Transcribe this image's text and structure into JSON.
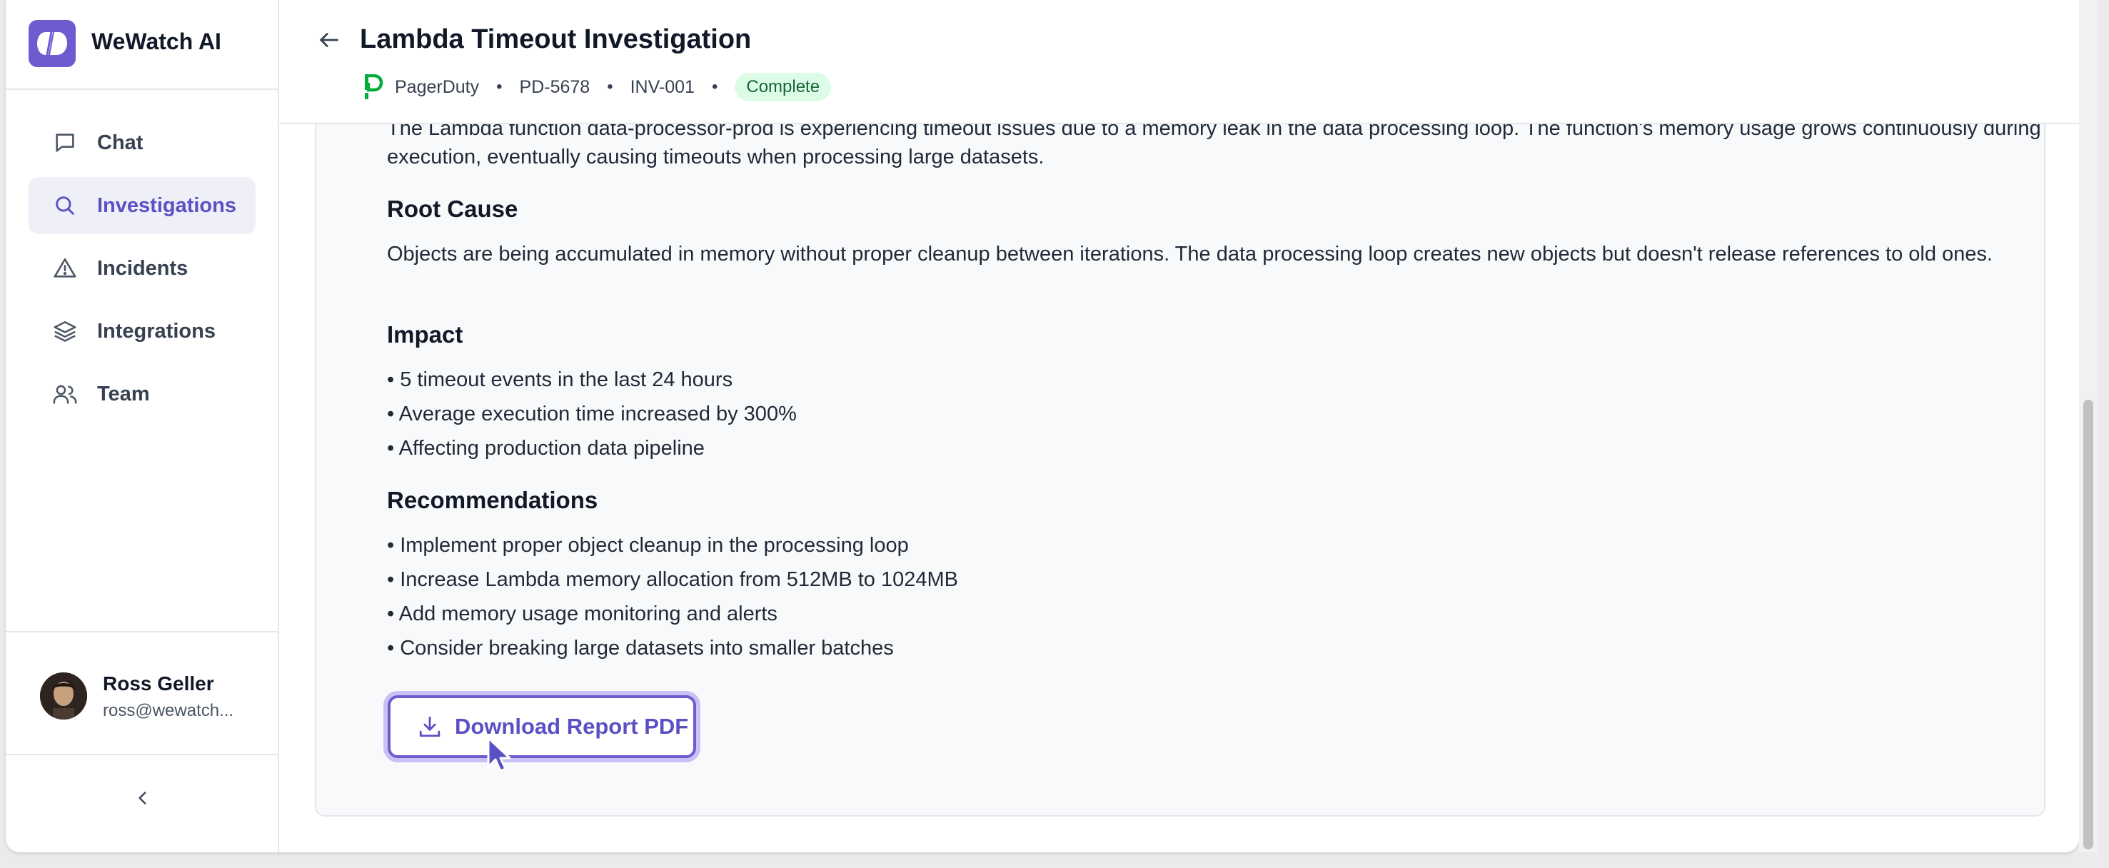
{
  "brand": {
    "name": "WeWatch AI",
    "logo_icon": "wewatch-logo-icon"
  },
  "nav": {
    "items": [
      {
        "label": "Chat",
        "icon": "chat-icon",
        "active": false
      },
      {
        "label": "Investigations",
        "icon": "search-icon",
        "active": true
      },
      {
        "label": "Incidents",
        "icon": "warning-icon",
        "active": false
      },
      {
        "label": "Integrations",
        "icon": "layers-icon",
        "active": false
      },
      {
        "label": "Team",
        "icon": "users-icon",
        "active": false
      }
    ]
  },
  "user": {
    "name": "Ross Geller",
    "email": "ross@wewatch..."
  },
  "header": {
    "title": "Lambda Timeout Investigation",
    "source": "PagerDuty",
    "incident_id": "PD-5678",
    "investigation_id": "INV-001",
    "status": "Complete"
  },
  "report": {
    "summary_text": "The Lambda function data-processor-prod is experiencing timeout issues due to a memory leak in the data processing loop. The function's memory usage grows continuously during execution, eventually causing timeouts when processing large datasets.",
    "root_cause_title": "Root Cause",
    "root_cause_text": "Objects are being accumulated in memory without proper cleanup between iterations. The data processing loop creates new objects but doesn't release references to old ones.",
    "impact_title": "Impact",
    "impact_items": [
      "• 5 timeout events in the last 24 hours",
      "• Average execution time increased by 300%",
      "• Affecting production data pipeline"
    ],
    "recommendations_title": "Recommendations",
    "recommendation_items": [
      "• Implement proper object cleanup in the processing loop",
      "• Increase Lambda memory allocation from 512MB to 1024MB",
      "• Add memory usage monitoring and alerts",
      "• Consider breaking large datasets into smaller batches"
    ],
    "download_label": "Download Report PDF"
  },
  "colors": {
    "accent": "#6d5bd0",
    "active_nav_bg": "#efeff8",
    "badge_bg": "#dcfce7",
    "badge_text": "#166534",
    "pagerduty_green": "#06ac38"
  }
}
